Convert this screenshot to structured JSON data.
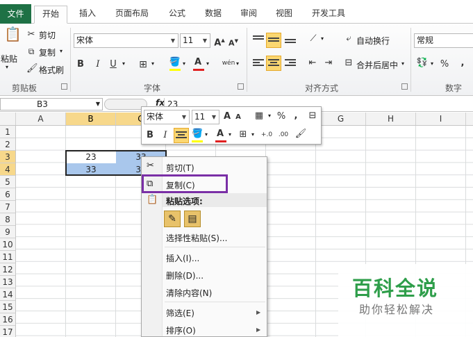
{
  "tabs": [
    "文件",
    "开始",
    "插入",
    "页面布局",
    "公式",
    "数据",
    "审阅",
    "视图",
    "开发工具"
  ],
  "ribbon": {
    "clipboard": {
      "paste": "粘贴",
      "cut": "剪切",
      "copy": "复制",
      "format_painter": "格式刷",
      "label": "剪贴板"
    },
    "font": {
      "name": "宋体",
      "size": "11",
      "label": "字体",
      "bold": "B",
      "italic": "I",
      "underline": "U",
      "grow": "A",
      "shrink": "A",
      "color_a": "A",
      "wen": "wén"
    },
    "alignment": {
      "wrap": "自动换行",
      "merge": "合并后居中",
      "label": "对齐方式"
    },
    "number": {
      "format": "常规",
      "percent": "%",
      "comma": ",",
      "label": "数字"
    }
  },
  "formula_bar": {
    "name_box": "B3",
    "fx": "fx",
    "value": "23"
  },
  "columns": [
    "A",
    "B",
    "C",
    "D",
    "E",
    "F",
    "G",
    "H",
    "I"
  ],
  "rows": [
    "1",
    "2",
    "3",
    "4",
    "5",
    "6",
    "7",
    "8",
    "9",
    "10",
    "11",
    "12",
    "13",
    "14",
    "15",
    "16",
    "17"
  ],
  "cells": {
    "b3": "23",
    "c3": "33",
    "b4": "33",
    "c4": "33"
  },
  "mini_toolbar": {
    "font": "宋体",
    "size": "11",
    "percent": "%",
    "comma": ",",
    "bold": "B",
    "italic": "I"
  },
  "context_menu": {
    "cut": "剪切(T)",
    "copy": "复制(C)",
    "paste_options": "粘贴选项:",
    "paste_special": "选择性粘贴(S)...",
    "insert": "插入(I)...",
    "delete": "删除(D)...",
    "clear": "清除内容(N)",
    "filter": "筛选(E)",
    "sort": "排序(O)"
  },
  "watermark": {
    "title": "百科全说",
    "subtitle": "助你轻松解决"
  },
  "colors": {
    "file_tab": "#1e7145",
    "selected_header": "#f7d88b",
    "selection_fill": "#a9c7ec",
    "highlight_box": "#7a2fa6",
    "watermark": "#2e9e4a"
  }
}
